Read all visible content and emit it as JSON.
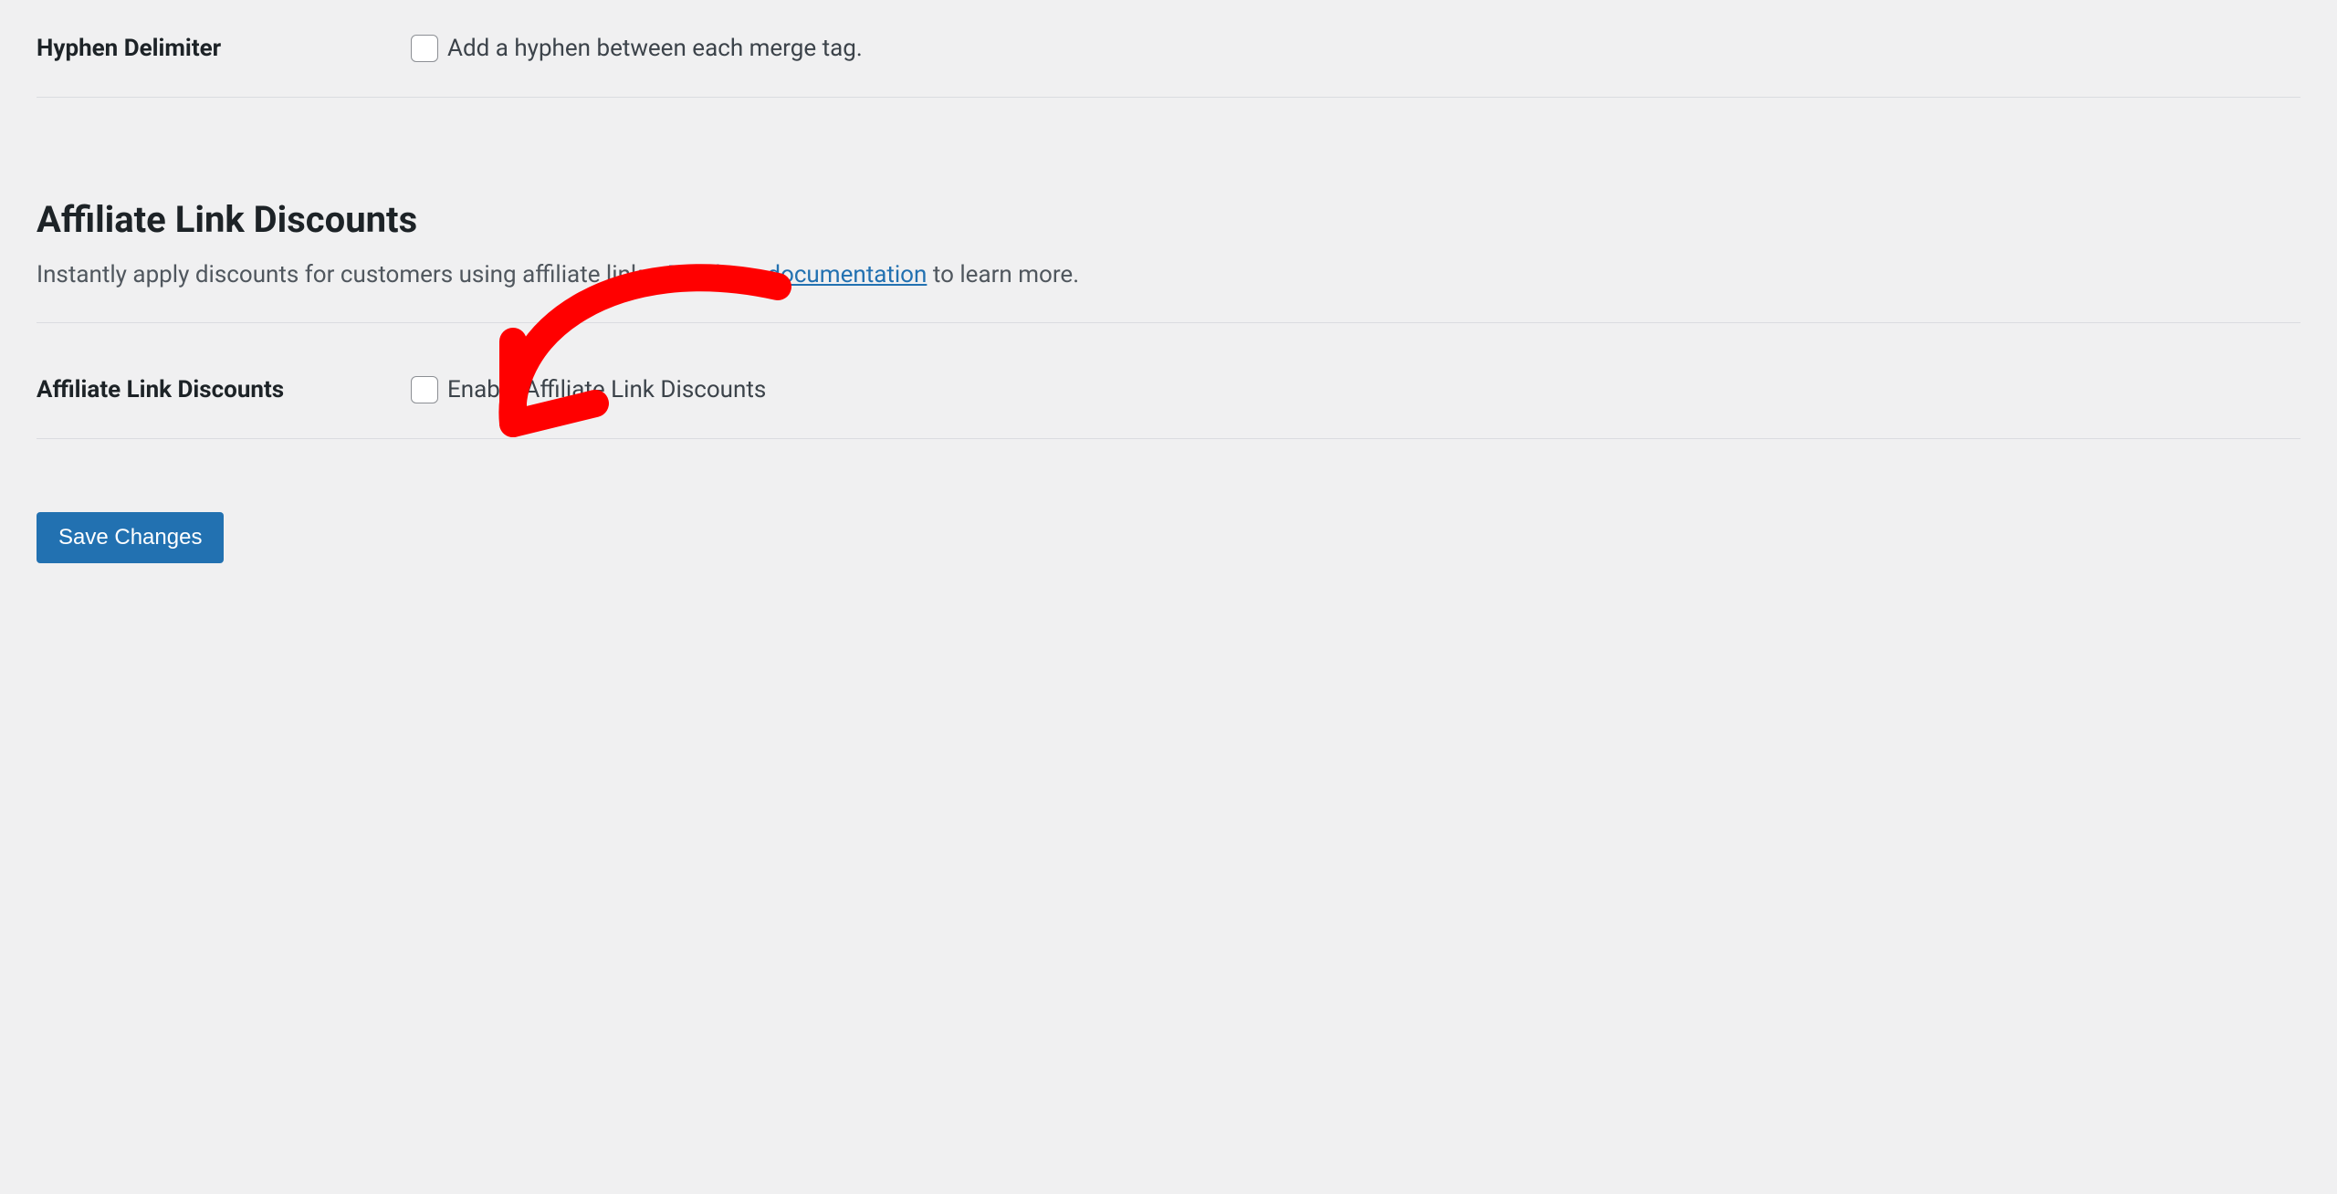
{
  "hyphen_section": {
    "label": "Hyphen Delimiter",
    "checkbox_label": "Add a hyphen between each merge tag."
  },
  "ald_section": {
    "heading": "Affiliate Link Discounts",
    "description_before": "Instantly apply discounts for customers using affiliate links. ",
    "description_link": "Read our documentation",
    "description_after": " to learn more.",
    "row_label": "Affiliate Link Discounts",
    "checkbox_label": "Enable Affiliate Link Discounts"
  },
  "buttons": {
    "save": "Save Changes"
  }
}
